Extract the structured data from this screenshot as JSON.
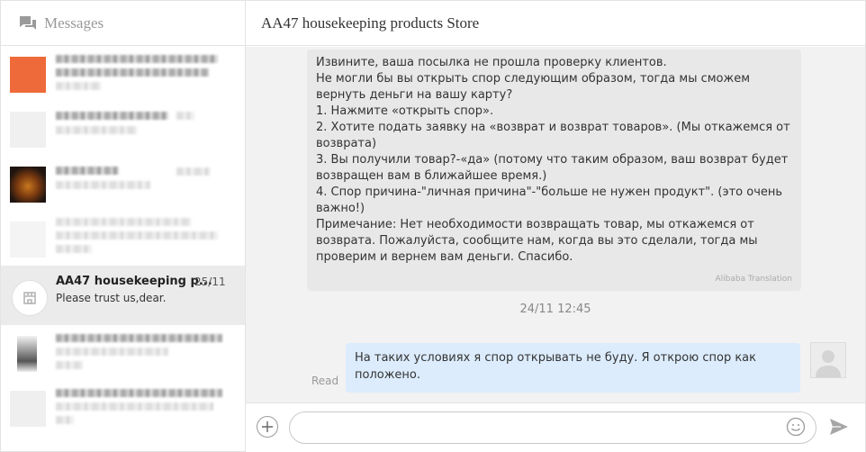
{
  "sidebar": {
    "title": "Messages",
    "conversations": [
      {
        "name": "AA47 housekeeping p...",
        "date": "25/11",
        "last_message": "Please trust us,dear."
      }
    ]
  },
  "chat": {
    "store_title": "AA47 housekeeping products Store",
    "incoming_message": "Извините, ваша посылка не прошла проверку клиентов.\nНе могли бы вы открыть спор следующим образом, тогда мы сможем вернуть деньги на вашу карту?\n1. Нажмите «открыть спор».\n2. Хотите подать заявку на «возврат и возврат товаров». (Мы откажемся от возврата)\n3. Вы получили товар?-«да» (потому что таким образом, ваш возврат будет возвращен вам в ближайшее время.)\n4. Спор причина-\"личная причина\"-\"больше не нужен продукт\". (это очень важно!)\nПримечание: Нет необходимости возвращать товар, мы откажемся от возврата. Пожалуйста, сообщите нам, когда вы это сделали, тогда мы проверим и вернем вам деньги. Спасибо.",
    "translation_label": "Alibaba Translation",
    "timestamp": "24/11 12:45",
    "outgoing_message": "На таких условиях я спор открывать не буду. Я открою спор как положено.",
    "read_status": "Read"
  },
  "composer": {
    "placeholder": ""
  },
  "icons": {
    "messages": "chat-bubbles-icon",
    "store": "store-icon",
    "add": "plus-icon",
    "emoji": "smiley-icon",
    "send": "paper-plane-icon",
    "user": "user-avatar-icon"
  },
  "colors": {
    "outgoing_bubble": "#dcecfd",
    "incoming_bubble": "#e8e8e8",
    "active_conversation": "#ebebeb",
    "thumb_orange": "#ee6a3a"
  }
}
